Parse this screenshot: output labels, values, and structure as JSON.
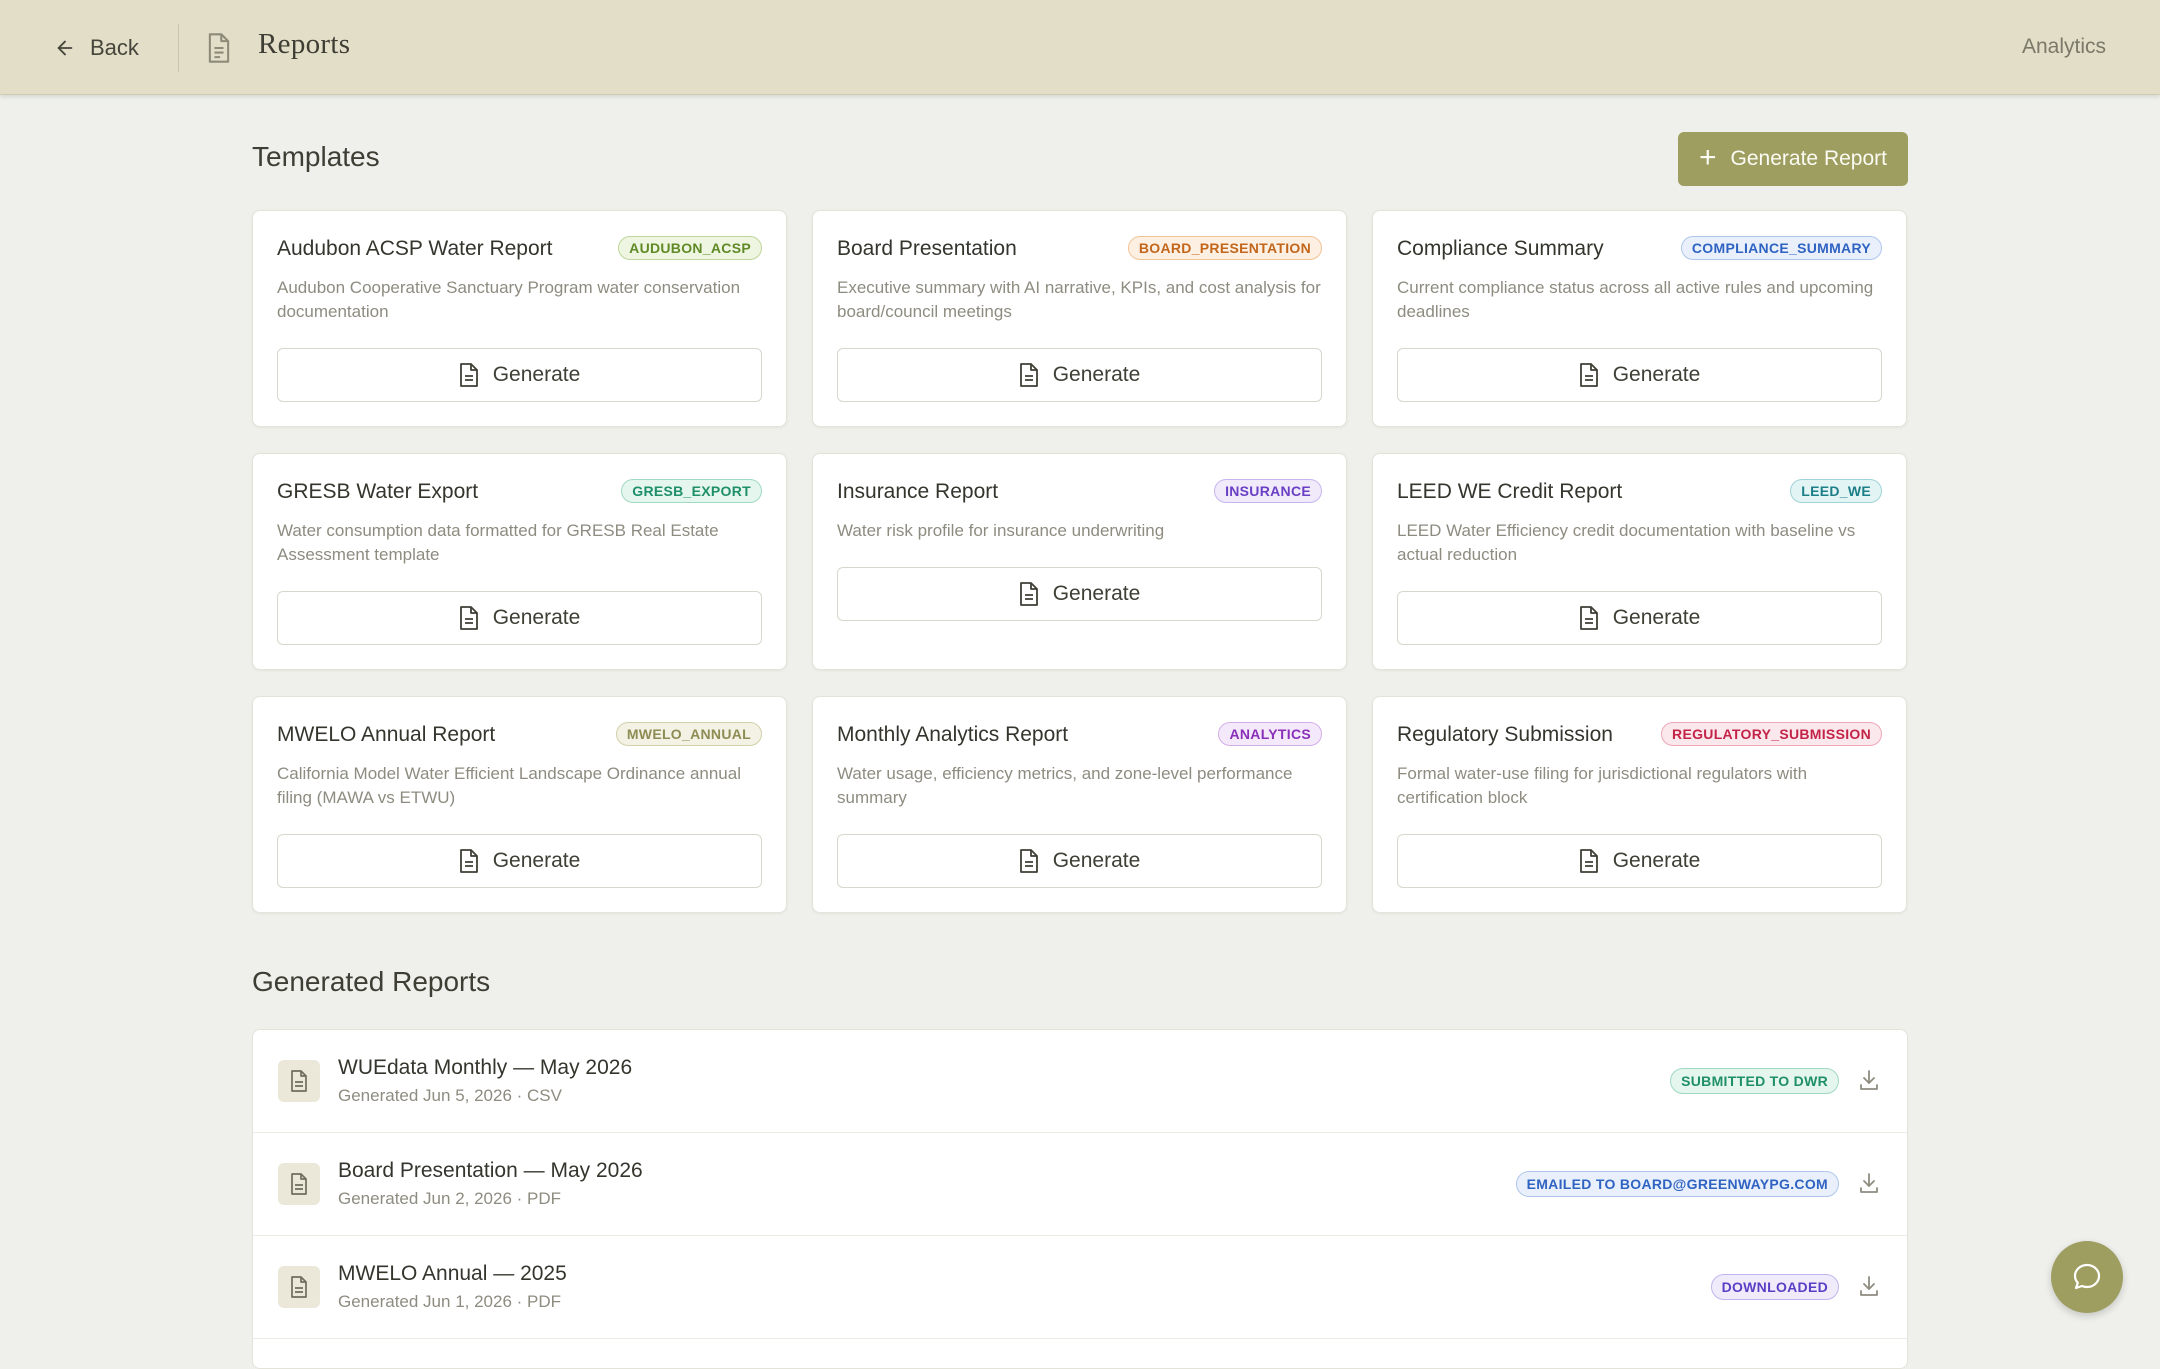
{
  "header": {
    "back_label": "Back",
    "title": "Reports",
    "nav_right": "Analytics"
  },
  "templates": {
    "section_title": "Templates",
    "generate_report_label": "Generate Report",
    "items": [
      {
        "name": "Audubon ACSP Water Report",
        "badge": "AUDUBON_ACSP",
        "desc": "Audubon Cooperative Sanctuary Program water conservation documentation",
        "button": "Generate",
        "badge_color": "#5f8a26",
        "badge_bg": "#eef5e0",
        "badge_border": "#bdd69a"
      },
      {
        "name": "Board Presentation",
        "badge": "BOARD_PRESENTATION",
        "desc": "Executive summary with AI narrative, KPIs, and cost analysis for board/council meetings",
        "button": "Generate",
        "badge_color": "#c2661c",
        "badge_bg": "#fdf0e2",
        "badge_border": "#f0c395"
      },
      {
        "name": "Compliance Summary",
        "badge": "COMPLIANCE_SUMMARY",
        "desc": "Current compliance status across all active rules and upcoming deadlines",
        "button": "Generate",
        "badge_color": "#2f63c2",
        "badge_bg": "#e9f0fb",
        "badge_border": "#aec6ec"
      },
      {
        "name": "GRESB Water Export",
        "badge": "GRESB_EXPORT",
        "desc": "Water consumption data formatted for GRESB Real Estate Assessment template",
        "button": "Generate",
        "badge_color": "#1f8f6a",
        "badge_bg": "#e5f6ef",
        "badge_border": "#9fd9c2"
      },
      {
        "name": "Insurance Report",
        "badge": "INSURANCE",
        "desc": "Water risk profile for insurance underwriting",
        "button": "Generate",
        "badge_color": "#6a3fc4",
        "badge_bg": "#f0eafb",
        "badge_border": "#c7b4ee"
      },
      {
        "name": "LEED WE Credit Report",
        "badge": "LEED_WE",
        "desc": "LEED Water Efficiency credit documentation with baseline vs actual reduction",
        "button": "Generate",
        "badge_color": "#1c7f88",
        "badge_bg": "#e3f4f5",
        "badge_border": "#9fd3d7"
      },
      {
        "name": "MWELO Annual Report",
        "badge": "MWELO_ANNUAL",
        "desc": "California Model Water Efficient Landscape Ordinance annual filing (MAWA vs ETWU)",
        "button": "Generate",
        "badge_color": "#8e8c54",
        "badge_bg": "#f3f2e4",
        "badge_border": "#d2d0a8"
      },
      {
        "name": "Monthly Analytics Report",
        "badge": "ANALYTICS",
        "desc": "Water usage, efficiency metrics, and zone-level performance summary",
        "button": "Generate",
        "badge_color": "#8a2fb8",
        "badge_bg": "#f4e9fa",
        "badge_border": "#d3aee8"
      },
      {
        "name": "Regulatory Submission",
        "badge": "REGULATORY_SUBMISSION",
        "desc": "Formal water-use filing for jurisdictional regulators with certification block",
        "button": "Generate",
        "badge_color": "#c42348",
        "badge_bg": "#fbe8ec",
        "badge_border": "#efa7b7"
      }
    ]
  },
  "generated": {
    "section_title": "Generated Reports",
    "rows": [
      {
        "name": "WUEdata Monthly — May 2026",
        "sub": "Generated Jun 5, 2026 · CSV",
        "status": "SUBMITTED TO DWR",
        "status_color": "#1f8f6a",
        "status_bg": "#e5f6ef",
        "status_border": "#9fd9c2"
      },
      {
        "name": "Board Presentation — May 2026",
        "sub": "Generated Jun 2, 2026 · PDF",
        "status": "EMAILED TO BOARD@GREENWAYPG.COM",
        "status_color": "#2f63c2",
        "status_bg": "#e9f0fb",
        "status_border": "#aec6ec"
      },
      {
        "name": "MWELO Annual — 2025",
        "sub": "Generated Jun 1, 2026 · PDF",
        "status": "DOWNLOADED",
        "status_color": "#5a3fc4",
        "status_bg": "#efebfb",
        "status_border": "#c3b6ee"
      }
    ]
  },
  "icons": {
    "back": "arrow-left-icon",
    "title": "file-icon",
    "plus": "plus-icon",
    "generate": "file-text-icon",
    "download": "download-icon",
    "chat": "chat-bubble-icon"
  },
  "colors": {
    "accent": "#9e9e61",
    "header_bg": "#e3dec8",
    "page_bg": "#eff0eb"
  }
}
